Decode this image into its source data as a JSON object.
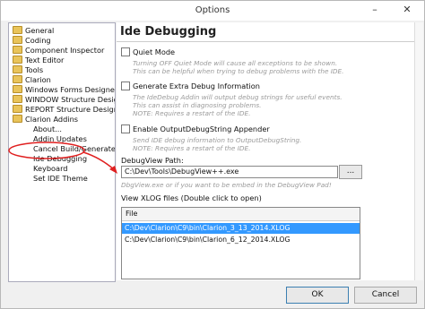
{
  "window": {
    "title": "Options",
    "minimize_glyph": "–",
    "close_glyph": "✕"
  },
  "tree": {
    "items": [
      {
        "label": "General",
        "icon": "folder-icon"
      },
      {
        "label": "Coding",
        "icon": "folder-icon"
      },
      {
        "label": "Component Inspector",
        "icon": "folder-icon"
      },
      {
        "label": "Text Editor",
        "icon": "folder-icon"
      },
      {
        "label": "Tools",
        "icon": "folder-icon"
      },
      {
        "label": "Clarion",
        "icon": "folder-icon"
      },
      {
        "label": "Windows Forms Designer",
        "icon": "folder-icon"
      },
      {
        "label": "WINDOW Structure Designer",
        "icon": "folder-icon"
      },
      {
        "label": "REPORT Structure Designer",
        "icon": "folder-icon"
      },
      {
        "label": "Clarion Addins",
        "icon": "folder-icon"
      },
      {
        "label": "About..."
      },
      {
        "label": "Addin Updates"
      },
      {
        "label": "Cancel Build/Generate Butto"
      },
      {
        "label": "Ide Debugging",
        "selected": true
      },
      {
        "label": "Keyboard"
      },
      {
        "label": "Set IDE Theme"
      }
    ]
  },
  "panel": {
    "title": "Ide Debugging",
    "quiet_mode": {
      "label": "Quiet Mode",
      "checked": false,
      "desc1": "Turning OFF Quiet Mode will cause all exceptions to be shown.",
      "desc2": "This can be helpful when trying to debug problems with the IDE."
    },
    "extra_debug": {
      "label": "Generate Extra Debug Information",
      "checked": false,
      "desc1": "The IdeDebug Addin will output debug strings for useful events.",
      "desc2": "This can assist in diagnosing problems.",
      "desc3": "NOTE: Requires a restart of the IDE."
    },
    "appender": {
      "label": "Enable OutputDebugString Appender",
      "checked": false,
      "desc1": "Send IDE debug information to OutputDebugString.",
      "desc2": "NOTE: Requires a restart of the IDE."
    },
    "debugview": {
      "label": "DebugView Path:",
      "value": "C:\\Dev\\Tools\\DebugView++.exe",
      "browse_label": "...",
      "desc": "DbgView.exe or if you want to be embed in the DebugView Pad!"
    },
    "xlog": {
      "label": "View XLOG files (Double click to open)",
      "column_header": "File",
      "rows": [
        {
          "file": "C:\\Dev\\Clarion\\C9\\bin\\Clarion_3_13_2014.XLOG",
          "selected": true
        },
        {
          "file": "C:\\Dev\\Clarion\\C9\\bin\\Clarion_6_12_2014.XLOG",
          "selected": false
        }
      ]
    }
  },
  "buttons": {
    "ok": "OK",
    "cancel": "Cancel"
  },
  "colors": {
    "selection": "#3399ff",
    "annotation": "#e02020",
    "folder": "#e9c45a"
  }
}
